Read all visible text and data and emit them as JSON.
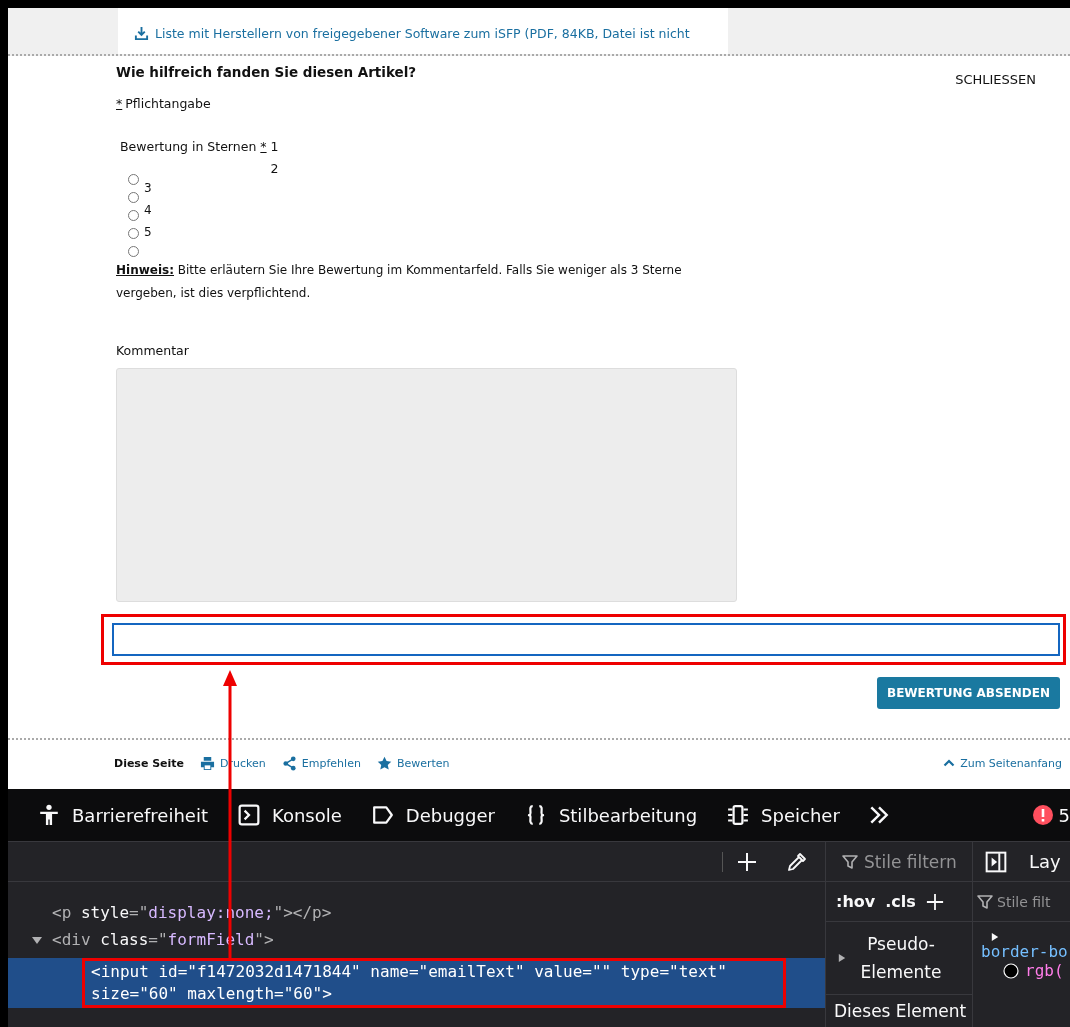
{
  "top_link": {
    "text": "Liste mit Herstellern von freigegebener Software zum iSFP (PDF, 84KB, Datei ist nicht"
  },
  "feedback": {
    "title": "Wie hilfreich fanden Sie diesen Artikel?",
    "close": "SCHLIESSEN",
    "required_mark": "*",
    "required_note": "Pflichtangabe",
    "rating_legend": "Bewertung in Sternen",
    "rating_required_mark": "*",
    "rating_options": [
      {
        "label": "1",
        "selected": false
      },
      {
        "label": "2",
        "selected": false
      },
      {
        "label": "3",
        "selected": false
      },
      {
        "label": "4",
        "selected": false
      },
      {
        "label": "5",
        "selected": false
      }
    ],
    "hint": "**Hinweis:** Bitte erläutern Sie Ihre Bewertung im Kommentarfeld. Falls Sie weniger als 3 Sterne vergeben, ist dies verpflichtend.",
    "comment_label": "Kommentar",
    "email_field": {
      "focused": true
    },
    "submit": "BEWERTUNG ABSENDEN"
  },
  "footer": {
    "label": "Diese Seite",
    "actions": [
      {
        "kind": "printer",
        "label": "Drucken"
      },
      {
        "kind": "share",
        "label": "Empfehlen"
      },
      {
        "kind": "star",
        "label": "Bewerten"
      }
    ],
    "top_link": "Zum Seitenanfang"
  },
  "devtools": {
    "tabs": [
      {
        "kind": "accessibility",
        "label": "Barrierefreiheit",
        "selected": false
      },
      {
        "kind": "console",
        "label": "Konsole",
        "selected": false
      },
      {
        "kind": "debugger",
        "label": "Debugger",
        "selected": false
      },
      {
        "kind": "braces",
        "label": "Stilbearbeitung",
        "selected": false
      },
      {
        "kind": "storage",
        "label": "Speicher",
        "selected": false
      }
    ],
    "error_count": "5",
    "markup_lines": [
      {
        "selected": false,
        "segments": [
          {
            "kind": "tag",
            "text": "<p"
          },
          {
            "kind": "attr",
            "text": " style"
          },
          {
            "kind": "tag",
            "text": "=\""
          },
          {
            "kind": "value",
            "text": "display:none;"
          },
          {
            "kind": "tag",
            "text": "\"></p>"
          }
        ]
      },
      {
        "selected": false,
        "expanded": true,
        "segments": [
          {
            "kind": "tag",
            "text": "<div"
          },
          {
            "kind": "attr",
            "text": " class"
          },
          {
            "kind": "tag",
            "text": "=\""
          },
          {
            "kind": "value",
            "text": "formField"
          },
          {
            "kind": "tag",
            "text": "\">"
          }
        ]
      },
      {
        "selected": true,
        "segments": [
          {
            "kind": "tag",
            "text": "<input"
          },
          {
            "kind": "attr",
            "text": " id"
          },
          {
            "kind": "tag",
            "text": "=\""
          },
          {
            "kind": "value",
            "text": "f1472032d1471844"
          },
          {
            "kind": "tag",
            "text": "\""
          },
          {
            "kind": "attr",
            "text": " name"
          },
          {
            "kind": "tag",
            "text": "=\""
          },
          {
            "kind": "value",
            "text": "emailText"
          },
          {
            "kind": "tag",
            "text": "\""
          },
          {
            "kind": "attr",
            "text": " value"
          },
          {
            "kind": "tag",
            "text": "=\"\""
          },
          {
            "kind": "attr",
            "text": " type"
          },
          {
            "kind": "tag",
            "text": "=\""
          },
          {
            "kind": "value",
            "text": "text"
          },
          {
            "kind": "tag",
            "text": "\""
          },
          {
            "kind": "attr",
            "text": " size"
          },
          {
            "kind": "tag",
            "text": "=\""
          },
          {
            "kind": "value",
            "text": "60"
          },
          {
            "kind": "tag",
            "text": "\""
          },
          {
            "kind": "attr",
            "text": " maxlength"
          },
          {
            "kind": "tag",
            "text": "=\""
          },
          {
            "kind": "value",
            "text": "60"
          },
          {
            "kind": "tag",
            "text": "\">"
          }
        ]
      }
    ],
    "rules_panel": {
      "filter_placeholder": "Stile filtern",
      "hov": ":hov",
      "cls": ".cls",
      "pseudo": "Pseudo-Elemente",
      "this_element": "Dieses Element"
    },
    "layout_panel": {
      "tab": "Lay",
      "filter_placeholder": "Stile filt",
      "property": "border-bo",
      "value": "rgb("
    }
  }
}
